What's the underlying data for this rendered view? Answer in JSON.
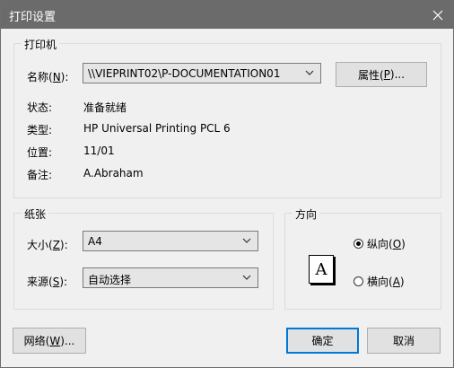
{
  "window": {
    "title": "打印设置",
    "close_icon": "close-icon"
  },
  "printer_group": {
    "title": "打印机",
    "name_label": "名称(",
    "name_key": "N",
    "name_label_end": "):",
    "name_value": "\\\\VIEPRINT02\\P-DOCUMENTATION01",
    "properties_label": "属性(",
    "properties_key": "P",
    "properties_label_end": ")...",
    "status_label": "状态:",
    "status_value": "准备就绪",
    "type_label": "类型:",
    "type_value": "HP Universal Printing PCL 6",
    "location_label": "位置:",
    "location_value": "11/01",
    "comment_label": "备注:",
    "comment_value": "A.Abraham"
  },
  "paper_group": {
    "title": "纸张",
    "size_label": "大小(",
    "size_key": "Z",
    "size_label_end": "):",
    "size_value": "A4",
    "source_label": "来源(",
    "source_key": "S",
    "source_label_end": "):",
    "source_value": "自动选择"
  },
  "orientation_group": {
    "title": "方向",
    "paper_glyph": "A",
    "portrait_label": "纵向(",
    "portrait_key": "O",
    "portrait_label_end": ")",
    "landscape_label": "横向(",
    "landscape_key": "A",
    "landscape_label_end": ")",
    "selected": "portrait"
  },
  "buttons": {
    "network_label": "网络(",
    "network_key": "W",
    "network_label_end": ")...",
    "ok_label": "确定",
    "cancel_label": "取消"
  },
  "colors": {
    "titlebar": "#6b6b6b",
    "background": "#f0f0f0",
    "accent": "#0078d7"
  }
}
